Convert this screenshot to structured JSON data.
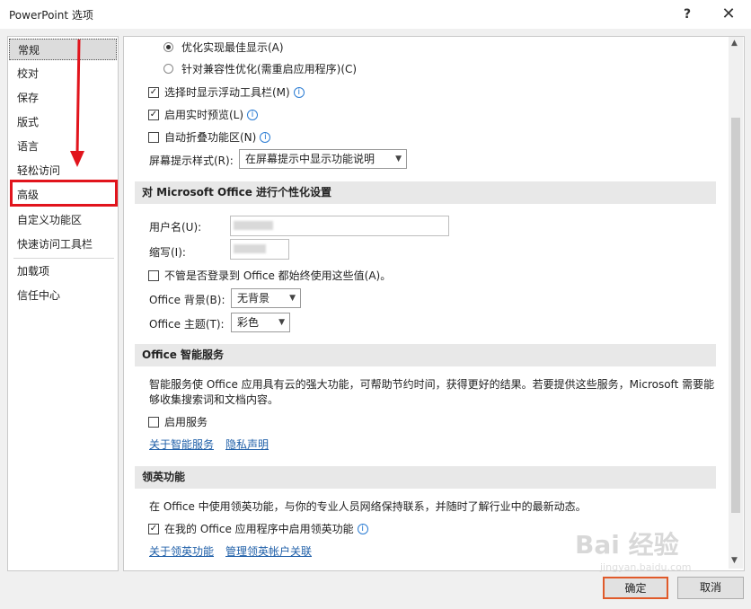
{
  "window": {
    "title": "PowerPoint 选项",
    "help": "?",
    "close": "✕"
  },
  "sidebar": {
    "items": [
      {
        "label": "常规"
      },
      {
        "label": "校对"
      },
      {
        "label": "保存"
      },
      {
        "label": "版式"
      },
      {
        "label": "语言"
      },
      {
        "label": "轻松访问"
      },
      {
        "label": "高级"
      },
      {
        "label": "自定义功能区"
      },
      {
        "label": "快速访问工具栏"
      },
      {
        "label": "加载项"
      },
      {
        "label": "信任中心"
      }
    ]
  },
  "general": {
    "radio_best": "优化实现最佳显示(A)",
    "radio_compat": "针对兼容性优化(需重启应用程序)(C)",
    "chk_minitoolbar": "选择时显示浮动工具栏(M)",
    "chk_livepreview": "启用实时预览(L)",
    "chk_collapse": "自动折叠功能区(N)",
    "tooltip_label": "屏幕提示样式(R):",
    "tooltip_value": "在屏幕提示中显示功能说明"
  },
  "personalize": {
    "header": "对 Microsoft Office 进行个性化设置",
    "username_label": "用户名(U):",
    "initials_label": "缩写(I):",
    "always_use": "不管是否登录到 Office 都始终使用这些值(A)。",
    "background_label": "Office 背景(B):",
    "background_value": "无背景",
    "theme_label": "Office 主题(T):",
    "theme_value": "彩色"
  },
  "intelligent": {
    "header": "Office 智能服务",
    "description": "智能服务使 Office 应用具有云的强大功能，可帮助节约时间，获得更好的结果。若要提供这些服务，Microsoft 需要能够收集搜索词和文档内容。",
    "enable": "启用服务",
    "link_about": "关于智能服务",
    "link_privacy": "隐私声明"
  },
  "linkedin": {
    "header": "领英功能",
    "description": "在 Office 中使用领英功能，与你的专业人员网络保持联系，并随时了解行业中的最新动态。",
    "enable": "在我的 Office 应用程序中启用领英功能",
    "link_about": "关于领英功能",
    "link_manage": "管理领英帐户关联"
  },
  "footer": {
    "ok": "确定",
    "cancel": "取消"
  },
  "watermark": {
    "main": "Bai 经验",
    "sub": "jingyan.baidu.com"
  },
  "colors": {
    "highlight": "#e1141c",
    "link": "#1f5fa8"
  }
}
